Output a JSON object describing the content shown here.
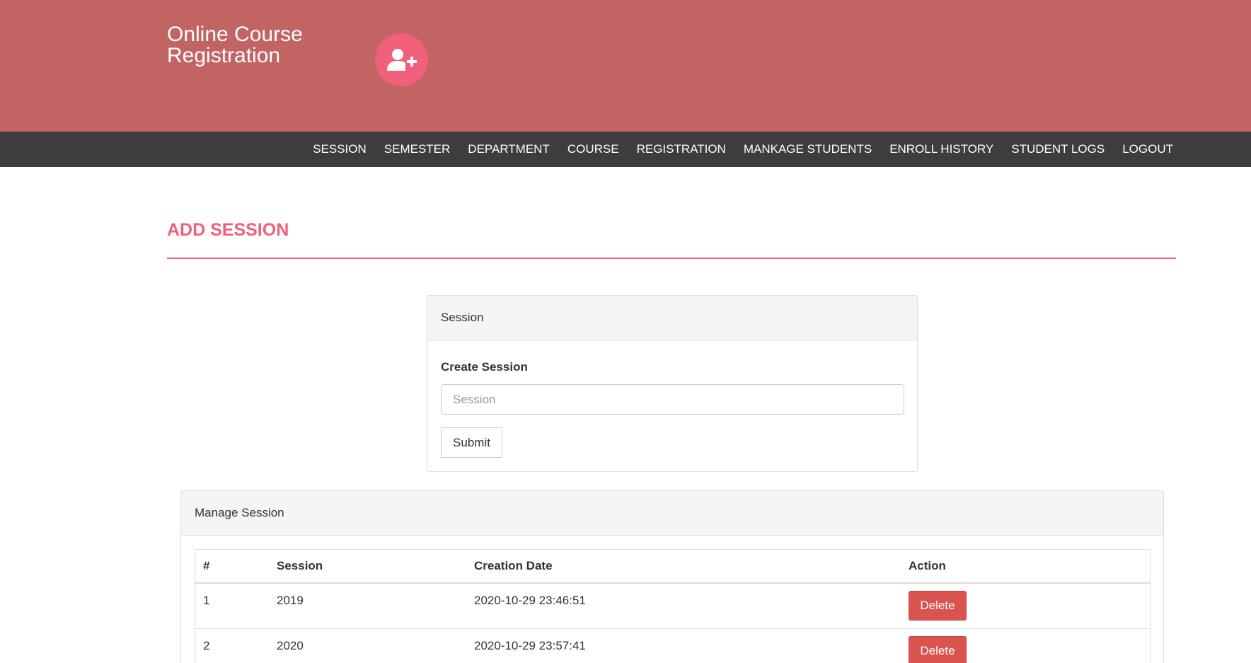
{
  "header": {
    "brand_line1": "Online Course",
    "brand_line2": "Registration",
    "logo_icon": "user-plus-icon",
    "background_color": "#c26464",
    "logo_circle_color": "#f0607a"
  },
  "nav": {
    "items": [
      {
        "label": "SESSION"
      },
      {
        "label": "SEMESTER"
      },
      {
        "label": "DEPARTMENT"
      },
      {
        "label": "COURSE"
      },
      {
        "label": "REGISTRATION"
      },
      {
        "label": "MANKAGE STUDENTS"
      },
      {
        "label": "ENROLL HISTORY"
      },
      {
        "label": "STUDENT LOGS"
      },
      {
        "label": "LOGOUT"
      }
    ],
    "background_color": "#3d3d3d"
  },
  "page": {
    "title": "ADD SESSION",
    "accent_color": "#f0607a"
  },
  "session_form": {
    "heading": "Session",
    "label": "Create Session",
    "input_value": "",
    "input_placeholder": "Session",
    "submit_label": "Submit"
  },
  "manage": {
    "heading": "Manage Session",
    "columns": [
      "#",
      "Session",
      "Creation Date",
      "Action"
    ],
    "rows": [
      {
        "num": "1",
        "session": "2019",
        "date": "2020-10-29 23:46:51",
        "action": "Delete"
      },
      {
        "num": "2",
        "session": "2020",
        "date": "2020-10-29 23:57:41",
        "action": "Delete"
      }
    ],
    "delete_color": "#d9534f"
  }
}
